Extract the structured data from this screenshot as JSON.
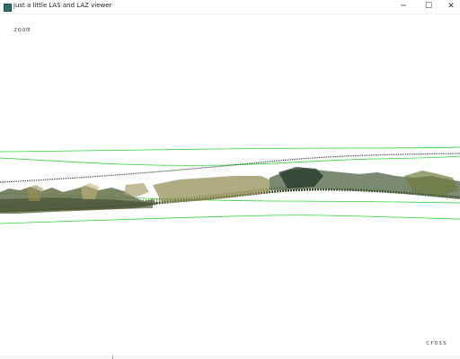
{
  "window": {
    "title": "just a little LAS and LAZ viewer",
    "minimize_glyph": "─",
    "maximize_glyph": "☐",
    "close_glyph": "✕",
    "icon": "app-icon"
  },
  "viewer": {
    "top_mode_label": "zoom",
    "bottom_mode_label": "cross",
    "background": "#ffffff",
    "bbox_color": "#2fd33c"
  }
}
